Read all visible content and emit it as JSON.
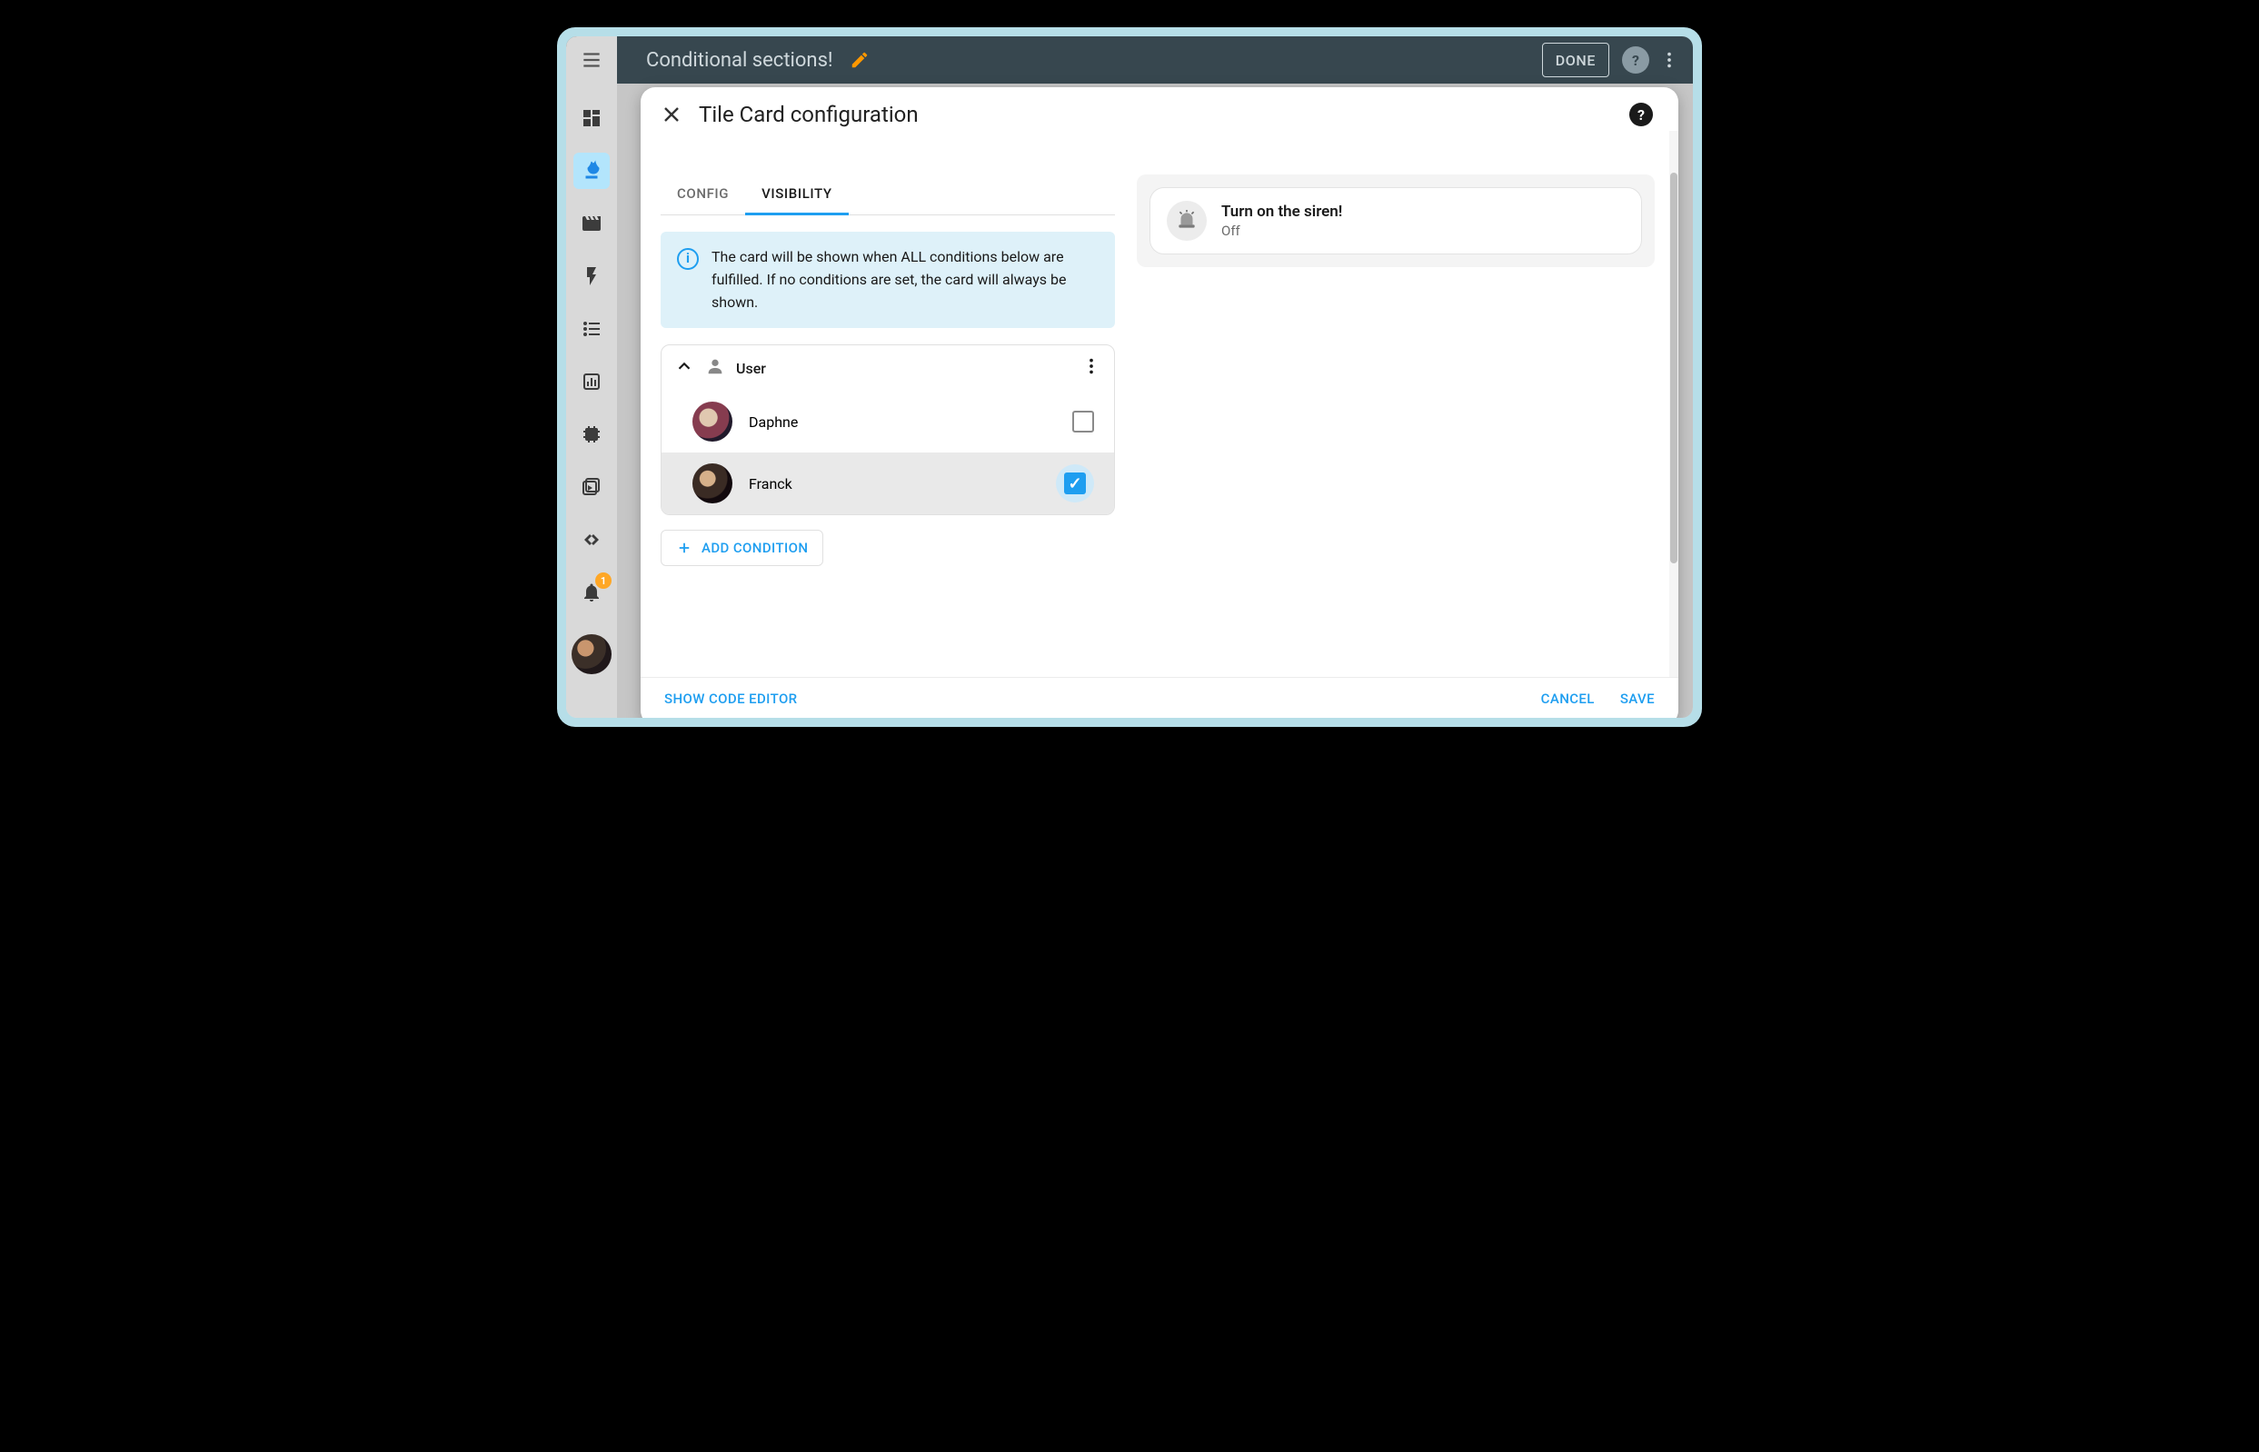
{
  "header": {
    "page_title": "Conditional sections!",
    "done_label": "DONE"
  },
  "sidebar": {
    "notification_count": "1"
  },
  "modal": {
    "title": "Tile Card configuration",
    "tabs": {
      "config": "CONFIG",
      "visibility": "VISIBILITY"
    },
    "info": "The card will be shown when ALL conditions below are fulfilled. If no conditions are set, the card will always be shown.",
    "condition_label": "User",
    "users": [
      {
        "name": "Daphne",
        "checked": false
      },
      {
        "name": "Franck",
        "checked": true
      }
    ],
    "add_condition_label": "ADD CONDITION",
    "show_code_editor": "SHOW CODE EDITOR",
    "cancel_label": "CANCEL",
    "save_label": "SAVE"
  },
  "preview": {
    "tile_title": "Turn on the siren!",
    "tile_subtitle": "Off"
  }
}
